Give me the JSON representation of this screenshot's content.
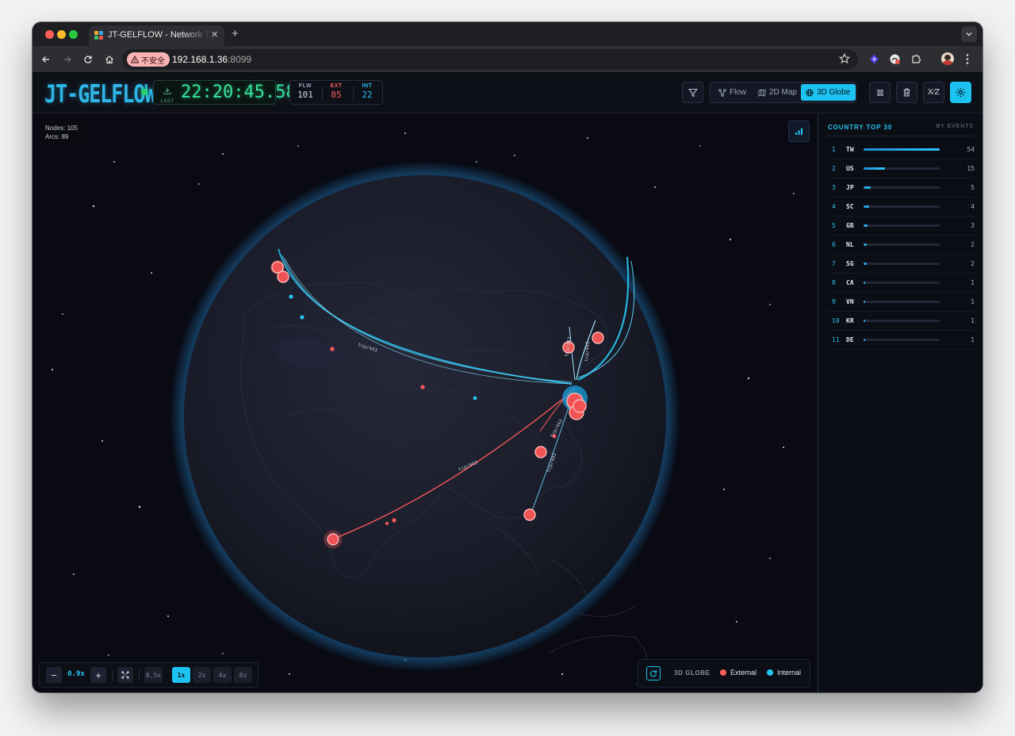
{
  "browser": {
    "tab_title": "JT-GELFLOW - Network Traffic",
    "url_host": "192.168.1.36",
    "url_port": ":8099",
    "insecure_label": "不安全"
  },
  "app": {
    "logo": "JT-GELFLOW",
    "clock": {
      "label": "LAST",
      "time": "22:20:45.58"
    },
    "stats": [
      {
        "key": "FLW",
        "value": "101",
        "color": "#d6dae2"
      },
      {
        "key": "EXT",
        "value": "85",
        "color": "#ff5b5b"
      },
      {
        "key": "INT",
        "value": "22",
        "color": "#27c4f0"
      }
    ],
    "views": [
      {
        "label": "Flow",
        "icon": "flow-icon",
        "active": false
      },
      {
        "label": "2D Map",
        "icon": "map-icon",
        "active": false
      },
      {
        "label": "3D Globe",
        "icon": "globe-icon",
        "active": true
      }
    ],
    "lang_toggle": "X⁄Z"
  },
  "graph_info": {
    "nodes": "Nodes: 105",
    "arcs": "Arcs: 89"
  },
  "controls": {
    "zoom_value": "0.9x",
    "zoom_out": "−",
    "zoom_in": "+",
    "speeds": [
      {
        "label": "0.5x",
        "active": false
      },
      {
        "label": "1x",
        "active": true
      },
      {
        "label": "2x",
        "active": false
      },
      {
        "label": "4x",
        "active": false
      },
      {
        "label": "8x",
        "active": false
      }
    ]
  },
  "legend": {
    "title": "3D GLOBE",
    "items": [
      {
        "label": "External",
        "color": "#ff5b5b"
      },
      {
        "label": "Internal",
        "color": "#27c4f0"
      }
    ]
  },
  "country_panel": {
    "title": "COUNTRY TOP 30",
    "subtitle": "BY EVENTS",
    "rows": [
      {
        "rank": "1",
        "code": "TW",
        "count": 54
      },
      {
        "rank": "2",
        "code": "US",
        "count": 15
      },
      {
        "rank": "3",
        "code": "JP",
        "count": 5
      },
      {
        "rank": "4",
        "code": "SC",
        "count": 4
      },
      {
        "rank": "5",
        "code": "GB",
        "count": 3
      },
      {
        "rank": "6",
        "code": "NL",
        "count": 2
      },
      {
        "rank": "7",
        "code": "SG",
        "count": 2
      },
      {
        "rank": "8",
        "code": "CA",
        "count": 1
      },
      {
        "rank": "9",
        "code": "VN",
        "count": 1
      },
      {
        "rank": "10",
        "code": "KR",
        "count": 1
      },
      {
        "rank": "11",
        "code": "DE",
        "count": 1
      }
    ]
  },
  "colors": {
    "accent": "#1cc2f0",
    "external": "#ff5b5b",
    "internal": "#27c4f0",
    "clock": "#36e39c"
  }
}
